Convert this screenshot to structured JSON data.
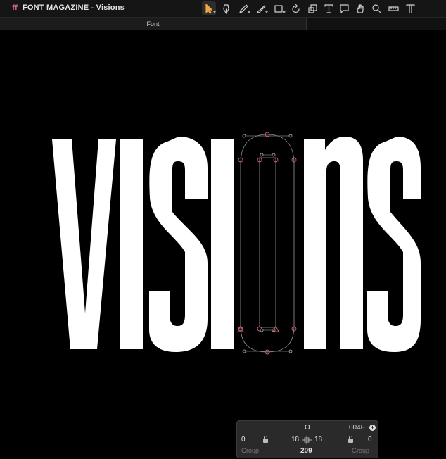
{
  "window": {
    "app_glyph": "ff",
    "title": "FONT MAGAZINE - Visions"
  },
  "toolbar": {
    "tools": [
      {
        "name": "select-tool",
        "icon": "arrow-pointer-icon",
        "active": true
      },
      {
        "name": "draw-tool",
        "icon": "pen-nib-icon"
      },
      {
        "name": "pen-tool",
        "icon": "pen-icon"
      },
      {
        "name": "brush-tool",
        "icon": "brush-icon"
      },
      {
        "name": "shape-tool",
        "icon": "rectangle-icon"
      },
      {
        "name": "rotate-tool",
        "icon": "rotate-icon"
      },
      {
        "name": "scale-tool",
        "icon": "scale-icon"
      },
      {
        "name": "text-tool",
        "icon": "text-icon"
      },
      {
        "name": "annotation-tool",
        "icon": "speech-bubble-icon"
      },
      {
        "name": "hand-tool",
        "icon": "hand-icon"
      },
      {
        "name": "zoom-tool",
        "icon": "magnifier-icon"
      },
      {
        "name": "measure-tool",
        "icon": "ruler-icon"
      },
      {
        "name": "type-tool",
        "icon": "text-cursor-icon"
      }
    ],
    "accent_color": "#f0a540"
  },
  "tabs": [
    {
      "label": "Font"
    }
  ],
  "canvas": {
    "word": "VISIONS",
    "glyph_color": "#ffffff",
    "background": "#000000",
    "selected_glyph": "O",
    "node_color": "#c8607a"
  },
  "info_panel": {
    "glyph_name": "O",
    "unicode": "004F",
    "lsb": "0",
    "rsb": "0",
    "lsb_label": "Group",
    "rsb_label": "Group",
    "left_metric": "18",
    "right_metric": "18",
    "width": "209"
  }
}
